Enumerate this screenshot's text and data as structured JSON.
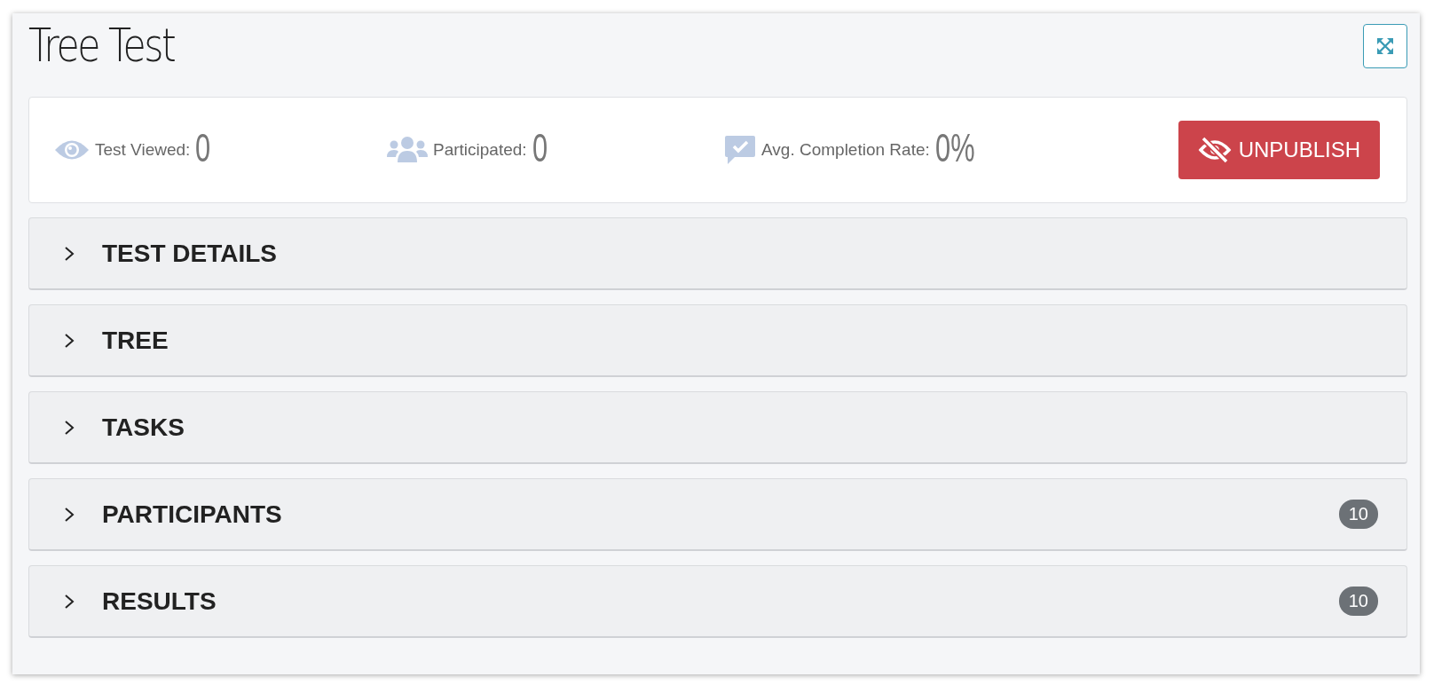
{
  "title": "Tree Test",
  "stats": [
    {
      "kind": "eye",
      "label": "Test Viewed:",
      "value": "0"
    },
    {
      "kind": "people",
      "label": "Participated:",
      "value": "0"
    },
    {
      "kind": "check",
      "label": "Avg. Completion Rate:",
      "value": "0%"
    }
  ],
  "unpublish_button": "UNPUBLISH",
  "sections": [
    {
      "label": "TEST DETAILS",
      "expanded": false
    },
    {
      "label": "TREE",
      "expanded": false
    },
    {
      "label": "TASKS",
      "expanded": false
    },
    {
      "label": "PARTICIPANTS",
      "expanded": false,
      "badge": "10"
    },
    {
      "label": "RESULTS",
      "expanded": false,
      "badge": "10"
    }
  ]
}
